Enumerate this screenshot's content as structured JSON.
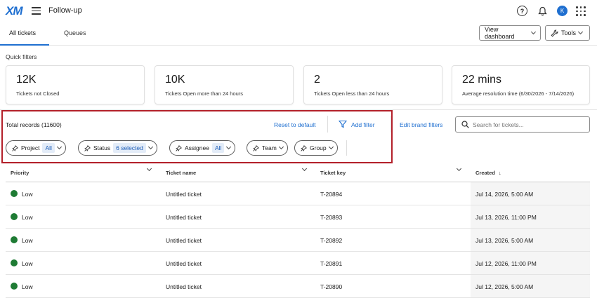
{
  "app": {
    "logo": "XM",
    "title": "Follow-up",
    "avatar_initial": "K"
  },
  "tabs": [
    {
      "label": "All tickets"
    },
    {
      "label": "Queues"
    }
  ],
  "toolbar": {
    "view_dashboard": "View dashboard",
    "tools": "Tools"
  },
  "quick_filters": {
    "label": "Quick filters",
    "cards": [
      {
        "value": "12K",
        "label": "Tickets not Closed"
      },
      {
        "value": "10K",
        "label": "Tickets Open more than 24 hours"
      },
      {
        "value": "2",
        "label": "Tickets Open less than 24 hours"
      },
      {
        "value": "22 mins",
        "label": "Average resolution time (6/30/2026 - 7/14/2026)"
      }
    ]
  },
  "filters": {
    "total_records": "Total records (11600)",
    "reset": "Reset to default",
    "add_filter": "Add filter",
    "edit_brand": "Edit brand filters",
    "search_placeholder": "Search for tickets...",
    "pills": [
      {
        "label": "Project",
        "tag": "All"
      },
      {
        "label": "Status",
        "tag": "6 selected"
      },
      {
        "label": "Assignee",
        "tag": "All"
      },
      {
        "label": "Team",
        "tag": ""
      },
      {
        "label": "Group",
        "tag": ""
      }
    ]
  },
  "table": {
    "columns": [
      "Priority",
      "Ticket name",
      "Ticket key",
      "Created"
    ],
    "sort_indicator": "↓",
    "status_color": "#1e7b34",
    "rows": [
      {
        "priority": "Low",
        "name": "Untitled ticket",
        "key": "T-20894",
        "created": "Jul 14, 2026, 5:00 AM"
      },
      {
        "priority": "Low",
        "name": "Untitled ticket",
        "key": "T-20893",
        "created": "Jul 13, 2026, 11:00 PM"
      },
      {
        "priority": "Low",
        "name": "Untitled ticket",
        "key": "T-20892",
        "created": "Jul 13, 2026, 5:00 AM"
      },
      {
        "priority": "Low",
        "name": "Untitled ticket",
        "key": "T-20891",
        "created": "Jul 12, 2026, 11:00 PM"
      },
      {
        "priority": "Low",
        "name": "Untitled ticket",
        "key": "T-20890",
        "created": "Jul 12, 2026, 5:00 AM"
      }
    ]
  }
}
